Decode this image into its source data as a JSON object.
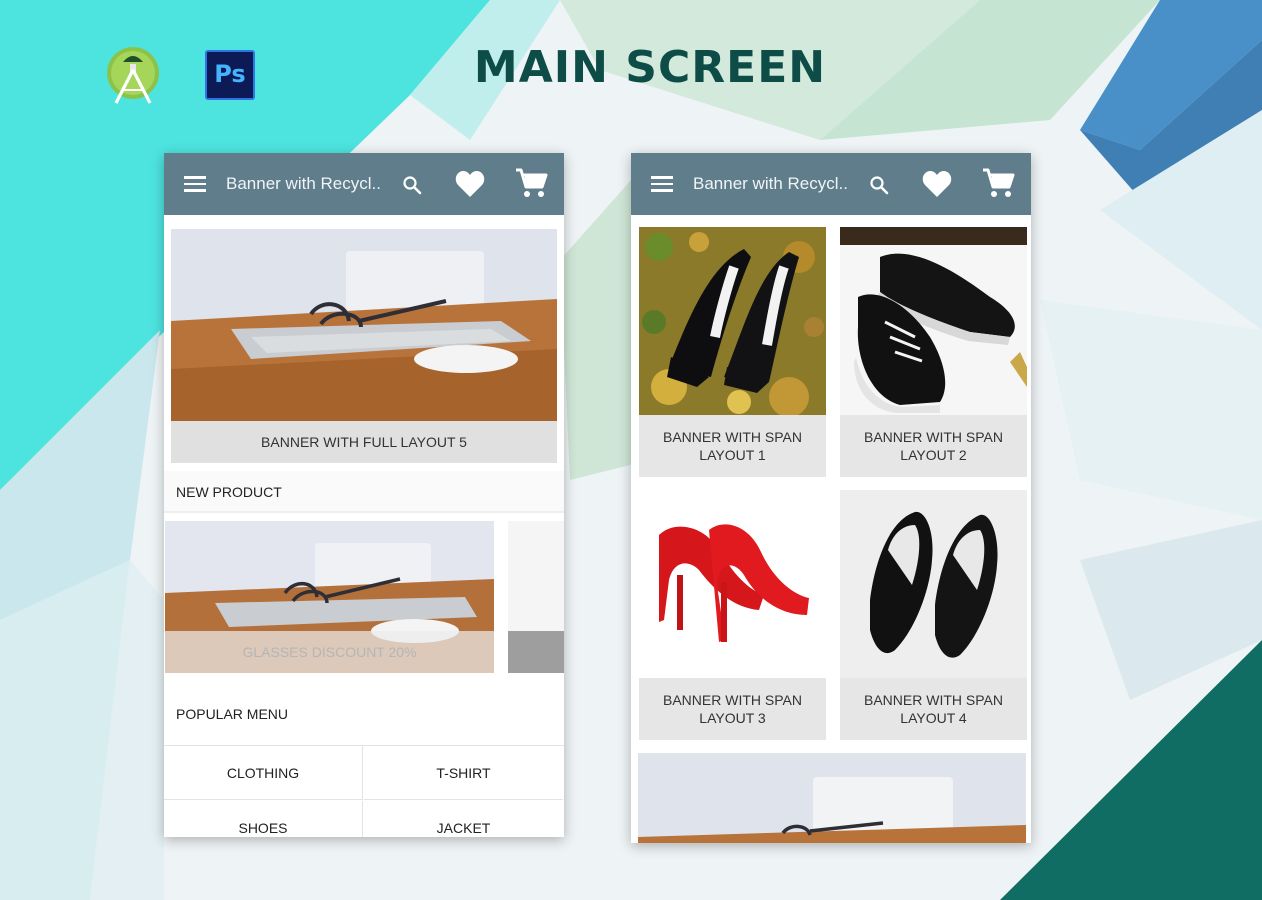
{
  "page": {
    "title": "MAIN SCREEN"
  },
  "logos": {
    "photoshop_text": "Ps",
    "android_color": "#8bc34a",
    "photoshop_color": "#0c1a55"
  },
  "colors": {
    "appbar": "#607d8b",
    "title": "#0e4d47",
    "accent_teal": "#4de3df",
    "dark_teal": "#0f6d64"
  },
  "left_phone": {
    "appbar": {
      "title": "Banner with Recycl..",
      "menu_icon": "hamburger-menu",
      "search_icon": "search",
      "favorite_icon": "heart",
      "cart_icon": "shopping-cart"
    },
    "banner": {
      "caption": "BANNER WITH FULL LAYOUT 5"
    },
    "new_product": {
      "heading": "NEW PRODUCT",
      "item_caption": "GLASSES DISCOUNT 20%"
    },
    "popular_menu": {
      "heading": "POPULAR MENU",
      "items": [
        "CLOTHING",
        "T-SHIRT",
        "SHOES",
        "JACKET"
      ]
    }
  },
  "right_phone": {
    "appbar": {
      "title": "Banner with Recycl..",
      "menu_icon": "hamburger-menu",
      "search_icon": "search",
      "favorite_icon": "heart",
      "cart_icon": "shopping-cart"
    },
    "cards": [
      {
        "caption": "BANNER WITH SPAN LAYOUT 1",
        "image": "black-heels-on-leaves"
      },
      {
        "caption": "BANNER WITH SPAN LAYOUT 2",
        "image": "black-sneakers"
      },
      {
        "caption": "BANNER WITH SPAN LAYOUT 3",
        "image": "red-heels"
      },
      {
        "caption": "BANNER WITH SPAN LAYOUT 4",
        "image": "black-heels"
      }
    ]
  }
}
